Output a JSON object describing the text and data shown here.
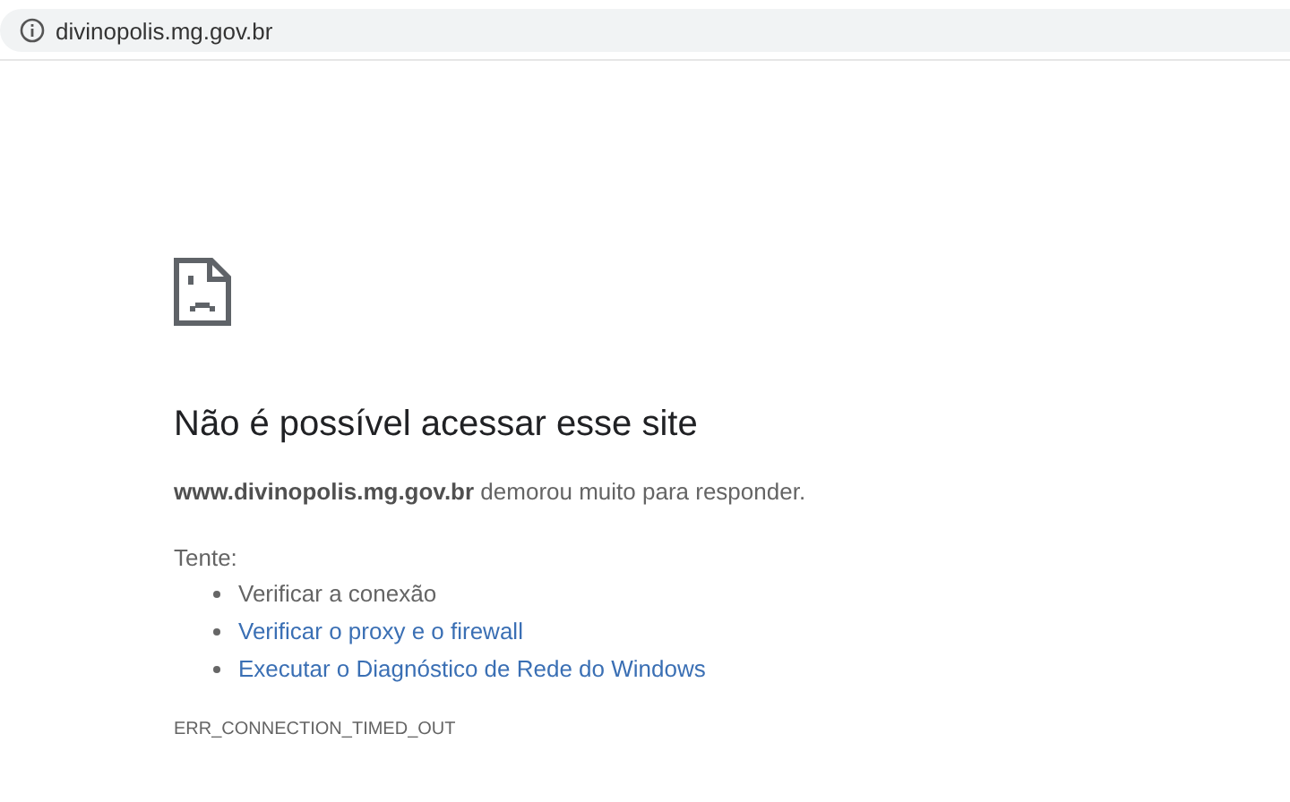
{
  "address_bar": {
    "url": "divinopolis.mg.gov.br"
  },
  "error": {
    "heading": "Não é possível acessar esse site",
    "message": "**www.divinopolis.mg.gov.br** demorou muito para responder.",
    "suggestions_label": "Tente:",
    "suggestions": [
      {
        "kind": "text",
        "label": "Verificar a conexão"
      },
      {
        "kind": "link",
        "label": "Verificar o proxy e o firewall"
      },
      {
        "kind": "link",
        "label": "Executar o Diagnóstico de Rede do Windows"
      }
    ],
    "code": "ERR_CONNECTION_TIMED_OUT"
  }
}
